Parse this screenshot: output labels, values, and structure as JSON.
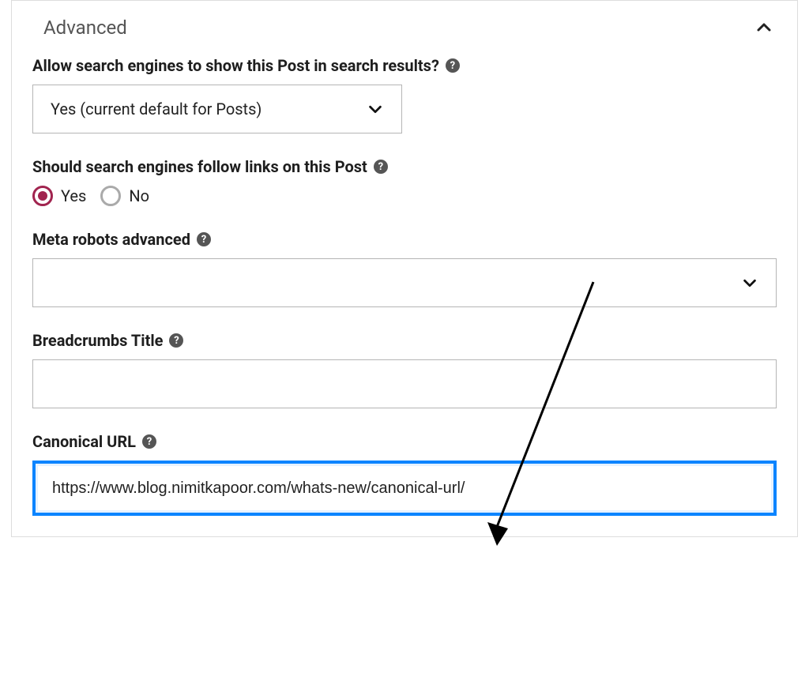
{
  "section": {
    "title": "Advanced"
  },
  "fields": {
    "allow_search": {
      "label": "Allow search engines to show this Post in search results?",
      "selected": "Yes (current default for Posts)"
    },
    "follow_links": {
      "label": "Should search engines follow links on this Post",
      "options": {
        "yes": "Yes",
        "no": "No"
      }
    },
    "meta_robots": {
      "label": "Meta robots advanced",
      "selected": ""
    },
    "breadcrumbs": {
      "label": "Breadcrumbs Title",
      "value": ""
    },
    "canonical": {
      "label": "Canonical URL",
      "value": "https://www.blog.nimitkapoor.com/whats-new/canonical-url/"
    }
  }
}
